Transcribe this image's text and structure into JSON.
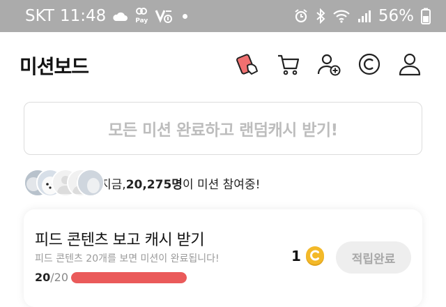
{
  "statusbar": {
    "carrier": "SKT",
    "time": "11:48",
    "battery": "56%",
    "pay_label": "Pay",
    "icons": [
      "cloud-icon",
      "samsung-pay-icon",
      "volte-icon",
      "dot-icon",
      "alarm-icon",
      "bluetooth-icon",
      "wifi-icon",
      "signal-icon",
      "battery-icon"
    ]
  },
  "header": {
    "title": "미션보드",
    "icons": [
      "mission-card-icon",
      "cart-icon",
      "add-friend-icon",
      "cash-coin-icon",
      "profile-icon"
    ]
  },
  "banner": {
    "text": "모든 미션 완료하고 랜덤캐시 받기!"
  },
  "participants": {
    "prefix": "지금, ",
    "count": "20,275명",
    "suffix": "이 미션 참여중!"
  },
  "mission": {
    "title": "피드 콘텐츠 보고 캐시 받기",
    "description": "피드 콘텐츠 20개를 보면 미션이 완료됩니다!",
    "progress_current": "20",
    "progress_total": "/20",
    "progress_fraction": 1.0,
    "reward": "1",
    "button_label": "적립완료"
  },
  "colors": {
    "statusbar_bg": "#ababab",
    "progress_fill": "#ea5a5a",
    "coin": "#f3b929",
    "mission_icon": "#f07070"
  }
}
